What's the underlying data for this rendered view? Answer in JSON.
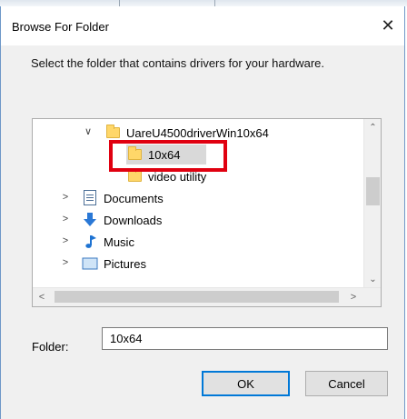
{
  "dialog": {
    "title": "Browse For Folder",
    "close_glyph": "✕",
    "instruction": "Select the folder that contains drivers for your hardware."
  },
  "tree": {
    "items": [
      {
        "label": "UareU4500driverWin10x64",
        "expander": "∨",
        "icon": "folder-icon",
        "indent": 2,
        "selected": false
      },
      {
        "label": "10x64",
        "expander": "",
        "icon": "folder-icon",
        "indent": 3,
        "selected": true
      },
      {
        "label": "video utility",
        "expander": "",
        "icon": "folder-icon",
        "indent": 3,
        "selected": false
      },
      {
        "label": "Documents",
        "expander": ">",
        "icon": "documents-icon",
        "indent": 1,
        "selected": false
      },
      {
        "label": "Downloads",
        "expander": ">",
        "icon": "download-arrow-icon",
        "indent": 1,
        "selected": false
      },
      {
        "label": "Music",
        "expander": ">",
        "icon": "music-note-icon",
        "indent": 1,
        "selected": false
      },
      {
        "label": "Pictures",
        "expander": ">",
        "icon": "pictures-icon",
        "indent": 1,
        "selected": false
      }
    ],
    "highlight_color": "#e00010",
    "scroll_up": "⌃",
    "scroll_down": "⌄",
    "scroll_left": "<",
    "scroll_right": ">"
  },
  "folder_field": {
    "label": "Folder:",
    "value": "10x64"
  },
  "buttons": {
    "ok": "OK",
    "cancel": "Cancel"
  },
  "colors": {
    "accent": "#0078d7",
    "window_border": "#6e98c8"
  }
}
